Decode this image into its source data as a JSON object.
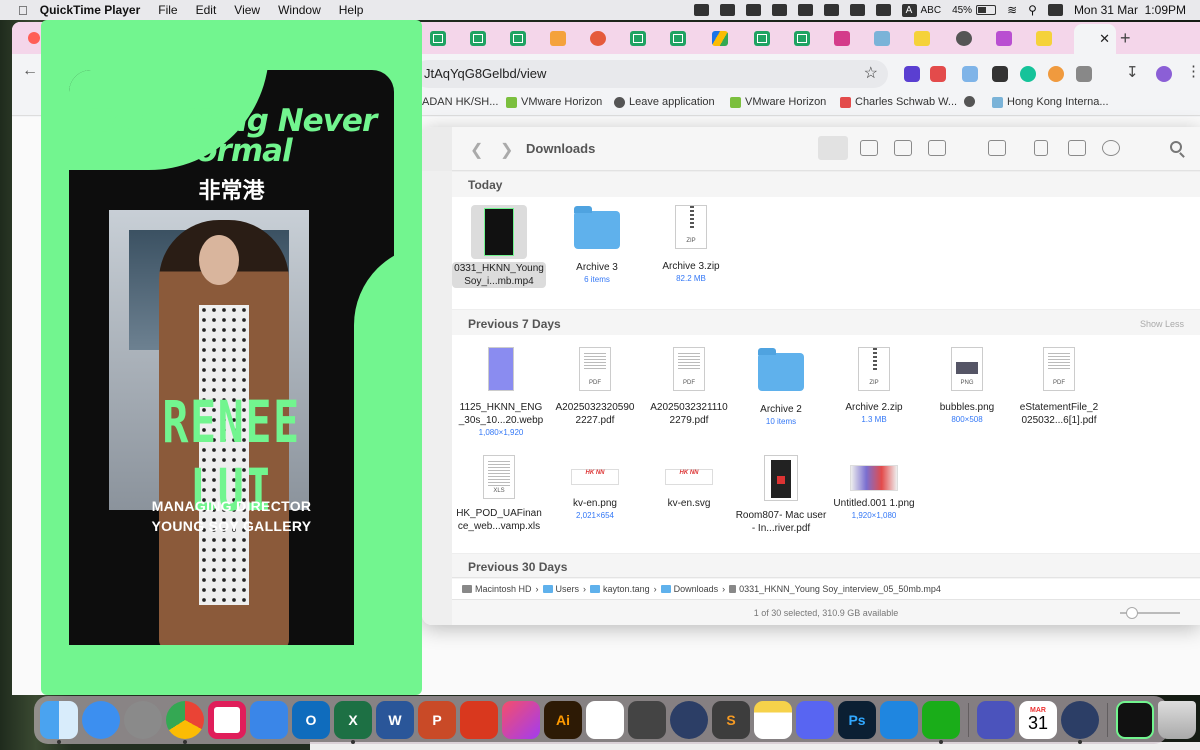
{
  "menubar": {
    "app": "QuickTime Player",
    "menus": [
      "File",
      "Edit",
      "View",
      "Window",
      "Help"
    ],
    "input_source": "ABC",
    "battery": "45%",
    "clock": "Mon 31 Mar  1:09PM"
  },
  "browser": {
    "url": "JtAqYqG8Gelbd/view",
    "bookmarks": [
      "ADAN HK/SH...",
      "VMware Horizon",
      "Leave application",
      "VMware Horizon",
      "Charles Schwab W...",
      "Hong Kong Interna..."
    ]
  },
  "finder": {
    "title": "Downloads",
    "sections": {
      "today": "Today",
      "previous7": "Previous 7 Days",
      "previous30": "Previous 30 Days",
      "show_less": "Show Less"
    },
    "today_items": [
      {
        "name": "0331_HKNN_Young Soy_i...mb.mp4",
        "meta": ""
      },
      {
        "name": "Archive 3",
        "meta": "6 items"
      },
      {
        "name": "Archive 3.zip",
        "meta": "82.2 MB"
      }
    ],
    "week_items": [
      {
        "name": "1125_HKNN_ENG _30s_10...20.webp",
        "meta": "1,080×1,920"
      },
      {
        "name": "A2025032320590 2227.pdf",
        "meta": ""
      },
      {
        "name": "A2025032321110 2279.pdf",
        "meta": ""
      },
      {
        "name": "Archive 2",
        "meta": "10 items"
      },
      {
        "name": "Archive 2.zip",
        "meta": "1.3 MB"
      },
      {
        "name": "bubbles.png",
        "meta": "800×508"
      },
      {
        "name": "eStatementFile_2 025032...6[1].pdf",
        "meta": ""
      },
      {
        "name": "HK_POD_UAFinan ce_web...vamp.xls",
        "meta": ""
      },
      {
        "name": "kv-en.png",
        "meta": "2,021×654"
      },
      {
        "name": "kv-en.svg",
        "meta": ""
      },
      {
        "name": "Room807-  Mac user - In...river.pdf",
        "meta": ""
      },
      {
        "name": "Untitled.001 1.png",
        "meta": "1,920×1,080"
      }
    ],
    "path": [
      "Macintosh HD",
      "Users",
      "kayton.tang",
      "Downloads",
      "0331_HKNN_Young Soy_interview_05_50mb.mp4"
    ],
    "status": "1 of 30 selected, 310.9 GB available"
  },
  "video": {
    "title": "Hong Kong Never Normal",
    "title_cn": "非常港",
    "name": "RENEE LUI",
    "role_line1": "MANAGING DIRECTOR",
    "role_line2": "YOUNG SOY GALLERY"
  },
  "dock": {
    "calendar_month": "MAR",
    "calendar_day": "31",
    "apps": [
      "finder-icon",
      "safari-icon",
      "settings-icon",
      "chrome-icon",
      "slack-icon",
      "keynote-icon",
      "outlook-icon",
      "excel-icon",
      "word-icon",
      "powerpoint-icon",
      "remote-icon",
      "creative-cloud-icon",
      "illustrator-icon",
      "reminders-icon",
      "calculator-icon",
      "proxyman-icon",
      "sublime-icon",
      "notes-icon",
      "discord-icon",
      "photoshop-icon",
      "windows-app-icon",
      "wechat-icon",
      "teams-icon",
      "calendar-icon",
      "quicktime-icon",
      "video-thumbnail",
      "trash-icon"
    ]
  },
  "colors": {
    "brand_green": "#72f58f",
    "accent_blue": "#3478f6"
  }
}
